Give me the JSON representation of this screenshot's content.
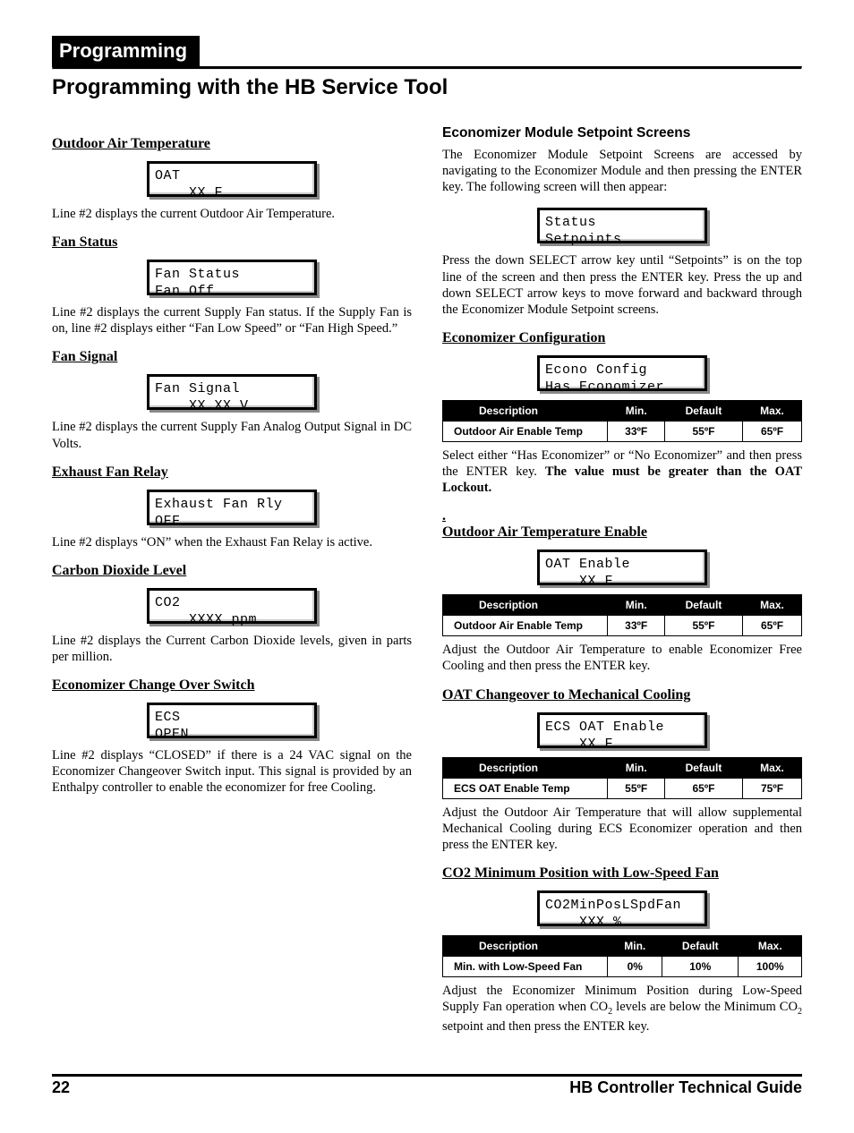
{
  "header": {
    "tab": "Programming",
    "title": "Programming with the HB Service Tool"
  },
  "left": {
    "s1": {
      "heading": "Outdoor Air Temperature",
      "lcd": "OAT\n    XX F",
      "body": "Line #2 displays the current Outdoor Air Temperature."
    },
    "s2": {
      "heading": "Fan Status",
      "lcd": "Fan Status\nFan Off",
      "body": "Line #2 displays the current Supply Fan status. If the Supply Fan is on, line #2 displays either “Fan Low Speed” or “Fan High Speed.”"
    },
    "s3": {
      "heading": "Fan Signal",
      "lcd": "Fan Signal\n    XX.XX V",
      "body": "Line #2 displays the current Supply Fan Analog Output Signal in DC Volts."
    },
    "s4": {
      "heading": "Exhaust Fan Relay",
      "lcd": "Exhaust Fan Rly\nOFF",
      "body": "Line #2 displays “ON” when the Exhaust Fan Relay is active."
    },
    "s5": {
      "heading": "Carbon Dioxide Level",
      "lcd": "CO2\n    XXXX ppm",
      "body": "Line #2 displays the Current Carbon Dioxide levels, given in parts per million."
    },
    "s6": {
      "heading": "Economizer Change Over Switch",
      "lcd": "ECS\nOPEN",
      "body": "Line #2 displays “CLOSED” if there is a 24 VAC signal on the Economizer Changeover Switch input. This signal is provided by an Enthalpy controller to enable the economizer for free Cooling."
    }
  },
  "right": {
    "intro_heading": "Economizer Module Setpoint Screens",
    "intro_body": "The Economizer Module Setpoint Screens are accessed by navigating to the Economizer Module and then pressing the ENTER key. The following screen will then appear:",
    "intro_lcd": "Status\nSetpoints",
    "intro_body2": "Press the down SELECT arrow key until “Setpoints” is on the top line of the screen and then press the ENTER key. Press the up and down SELECT arrow keys to move forward and backward through the Economizer Module Setpoint screens.",
    "th": {
      "desc": "Description",
      "min": "Min.",
      "def": "Default",
      "max": "Max."
    },
    "r1": {
      "heading": "Economizer Configuration",
      "lcd": "Econo Config\nHas Economizer",
      "row_desc": "Outdoor Air Enable Temp",
      "row_min": "33ºF",
      "row_def": "55ºF",
      "row_max": "65ºF",
      "body_pre": "Select either “Has Economizer” or “No Economizer” and then press the ENTER key. ",
      "body_bold": "The value must be greater than the OAT Lockout."
    },
    "r2": {
      "heading": "Outdoor Air Temperature Enable",
      "lcd": "OAT Enable\n    XX F",
      "row_desc": "Outdoor Air Enable Temp",
      "row_min": "33ºF",
      "row_def": "55ºF",
      "row_max": "65ºF",
      "body": "Adjust the Outdoor Air Temperature to enable Economizer Free Cooling and then press the ENTER key."
    },
    "r3": {
      "heading": "OAT Changeover to Mechanical Cooling",
      "lcd": "ECS OAT Enable\n    XX F",
      "row_desc": "ECS OAT Enable Temp",
      "row_min": "55ºF",
      "row_def": "65ºF",
      "row_max": "75ºF",
      "body": "Adjust the Outdoor Air Temperature that will allow supplemental Mechanical Cooling during ECS Economizer operation and then press the ENTER key."
    },
    "r4": {
      "heading": "CO2 Minimum Position with Low-Speed Fan",
      "lcd": "CO2MinPosLSpdFan\n    XXX %",
      "row_desc": "Min. with Low-Speed Fan",
      "row_min": "0%",
      "row_def": "10%",
      "row_max": "100%",
      "body_pre": "Adjust the Economizer Minimum Position during Low-Speed Supply Fan operation when CO",
      "body_mid": " levels are below the Minimum CO",
      "body_post": " setpoint and then press the ENTER key."
    }
  },
  "footer": {
    "page": "22",
    "title": "HB Controller Technical Guide"
  }
}
